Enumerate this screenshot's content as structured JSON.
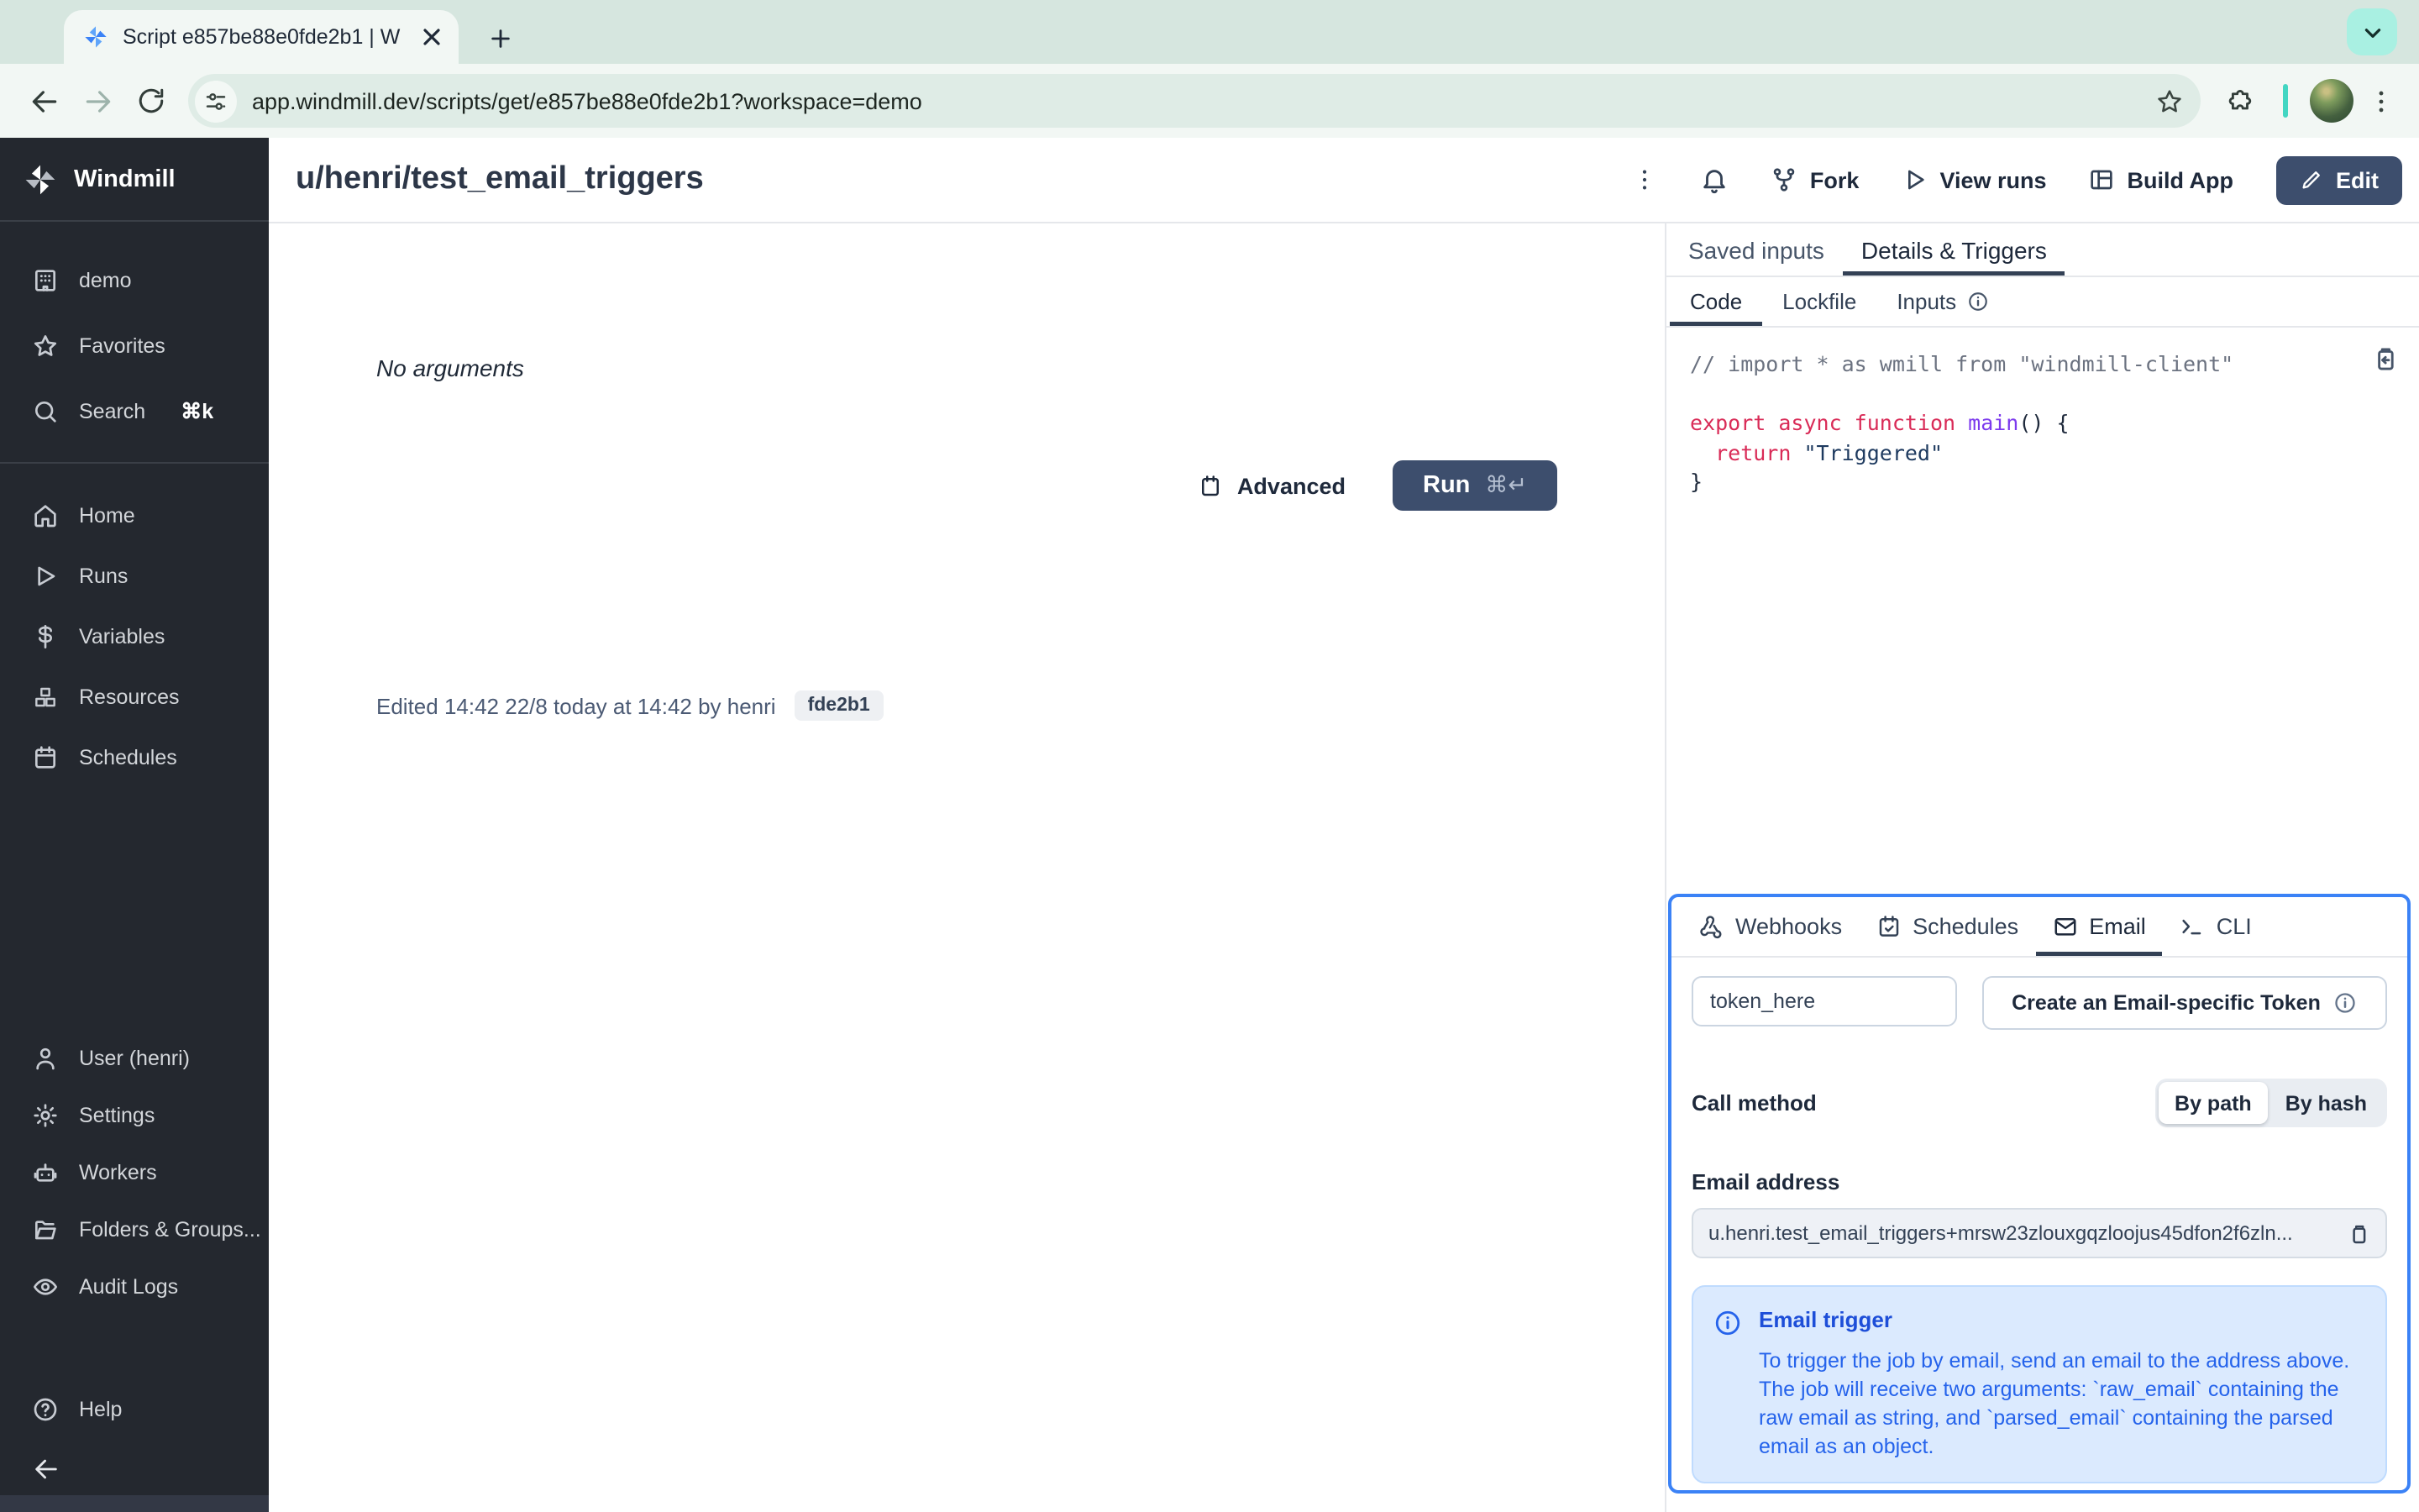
{
  "browser": {
    "tab_title": "Script e857be88e0fde2b1 | W",
    "url": "app.windmill.dev/scripts/get/e857be88e0fde2b1?workspace=demo"
  },
  "sidebar": {
    "brand": "Windmill",
    "workspace": [
      {
        "label": "demo"
      },
      {
        "label": "Favorites"
      },
      {
        "label": "Search",
        "shortcut": "⌘k"
      }
    ],
    "nav": [
      {
        "label": "Home"
      },
      {
        "label": "Runs"
      },
      {
        "label": "Variables"
      },
      {
        "label": "Resources"
      },
      {
        "label": "Schedules"
      }
    ],
    "admin": [
      {
        "label": "User (henri)"
      },
      {
        "label": "Settings"
      },
      {
        "label": "Workers"
      },
      {
        "label": "Folders & Groups..."
      },
      {
        "label": "Audit Logs"
      }
    ],
    "help_label": "Help"
  },
  "header": {
    "title": "u/henri/test_email_triggers",
    "fork_label": "Fork",
    "view_runs_label": "View runs",
    "build_app_label": "Build App",
    "edit_label": "Edit"
  },
  "main": {
    "no_arguments": "No arguments",
    "advanced_label": "Advanced",
    "run_label": "Run",
    "run_shortcut": "⌘↵",
    "edited_line": "Edited 14:42 22/8 today at 14:42 by henri",
    "version_badge": "fde2b1"
  },
  "details": {
    "tab_saved_inputs": "Saved inputs",
    "tab_details_triggers": "Details & Triggers",
    "subtab_code": "Code",
    "subtab_lockfile": "Lockfile",
    "subtab_inputs": "Inputs",
    "code": {
      "comment": "// import * as wmill from \"windmill-client\"",
      "kw_export": "export async function ",
      "fn_main": "main",
      "sig_rest": "() {",
      "kw_return": "  return ",
      "str_triggered": "\"Triggered\"",
      "brace_close": "}"
    }
  },
  "triggers": {
    "tab_webhooks": "Webhooks",
    "tab_schedules": "Schedules",
    "tab_email": "Email",
    "tab_cli": "CLI",
    "token_value": "token_here",
    "create_token_label": "Create an Email-specific Token",
    "call_method_label": "Call method",
    "by_path_label": "By path",
    "by_hash_label": "By hash",
    "email_address_label": "Email address",
    "email_address_value": "u.henri.test_email_triggers+mrsw23zlouxgqzloojus45dfon2f6zln...",
    "info_title": "Email trigger",
    "info_body": "To trigger the job by email, send an email to the address above. The job will receive two arguments: `raw_email` containing the raw email as string, and `parsed_email` containing the parsed email as an object."
  },
  "colors": {
    "accent_blue": "#3b82f6",
    "navy_button": "#3d4e6d",
    "sidebar_bg": "#24282f",
    "chrome_teal": "#43d6c2",
    "info_bg": "#dbeafe"
  }
}
